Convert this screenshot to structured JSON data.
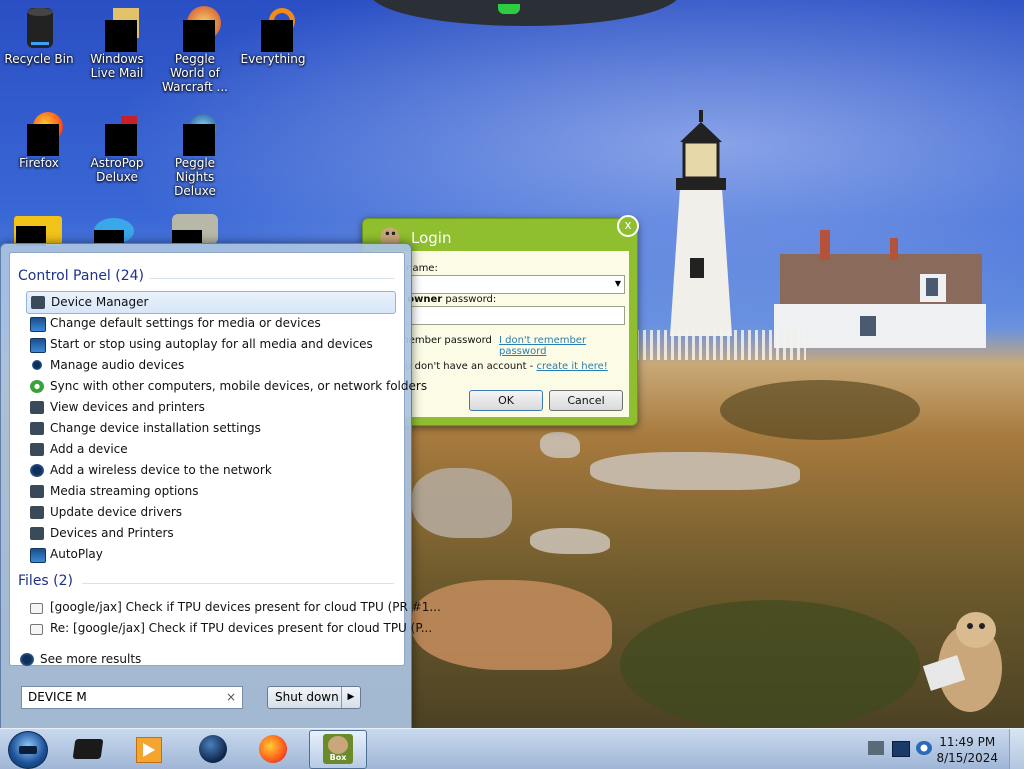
{
  "desktop_icons": [
    {
      "label": "Recycle Bin",
      "icon": "recycle-bin-icon"
    },
    {
      "label": "Windows Live Mail",
      "icon": "windows-live-mail-icon"
    },
    {
      "label": "Peggle World of Warcraft ...",
      "icon": "peggle-wow-icon"
    },
    {
      "label": "Everything",
      "icon": "everything-search-icon"
    },
    {
      "label": "Firefox",
      "icon": "firefox-icon"
    },
    {
      "label": "AstroPop Deluxe",
      "icon": "astropop-icon"
    },
    {
      "label": "Peggle Nights Deluxe",
      "icon": "peggle-nights-icon"
    }
  ],
  "login": {
    "title": "Login",
    "close_glyph": "x",
    "account_label": "t name:",
    "password_label_bold": "t owner",
    "password_label_rest": " password:",
    "remember_label": "member password",
    "forgot_link": "I don't remember password",
    "no_account_text": "ou don't have an account - ",
    "create_link": "create it here!",
    "ok_label": "OK",
    "cancel_label": "Cancel"
  },
  "start_menu": {
    "control_panel_header": "Control Panel (24)",
    "control_panel_items": [
      {
        "label": "Device Manager",
        "icon": "device-manager-icon"
      },
      {
        "label": "Change default settings for media or devices",
        "icon": "autoplay-icon"
      },
      {
        "label": "Start or stop using autoplay for all media and devices",
        "icon": "autoplay-icon"
      },
      {
        "label": "Manage audio devices",
        "icon": "speaker-icon"
      },
      {
        "label": "Sync with other computers, mobile devices, or network folders",
        "icon": "sync-center-icon"
      },
      {
        "label": "View devices and printers",
        "icon": "devices-printers-icon"
      },
      {
        "label": "Change device installation settings",
        "icon": "device-settings-icon"
      },
      {
        "label": "Add a device",
        "icon": "add-device-icon"
      },
      {
        "label": "Add a wireless device to the network",
        "icon": "wireless-device-icon"
      },
      {
        "label": "Media streaming options",
        "icon": "media-streaming-icon"
      },
      {
        "label": "Update device drivers",
        "icon": "driver-update-icon"
      },
      {
        "label": "Devices and Printers",
        "icon": "devices-printers-icon"
      },
      {
        "label": "AutoPlay",
        "icon": "autoplay-icon"
      }
    ],
    "files_header": "Files (2)",
    "file_items": [
      {
        "label": "[google/jax] Check if TPU devices present for cloud TPU (PR #1...",
        "icon": "mail-icon"
      },
      {
        "label": "Re: [google/jax] Check if TPU devices present for cloud TPU (P...",
        "icon": "mail-icon"
      }
    ],
    "see_more": "See more results",
    "search_value": "DEVICE M",
    "clear_glyph": "×",
    "shutdown_label": "Shut down",
    "shutdown_arrow": "▶"
  },
  "taskbar": {
    "apps": [
      "media-center-icon",
      "windows-media-player-icon",
      "globe-browser-icon",
      "firefox-icon",
      "box-app-icon"
    ],
    "active_app_label": "Box",
    "clock_time": "11:49 PM",
    "clock_date": "8/15/2024"
  }
}
